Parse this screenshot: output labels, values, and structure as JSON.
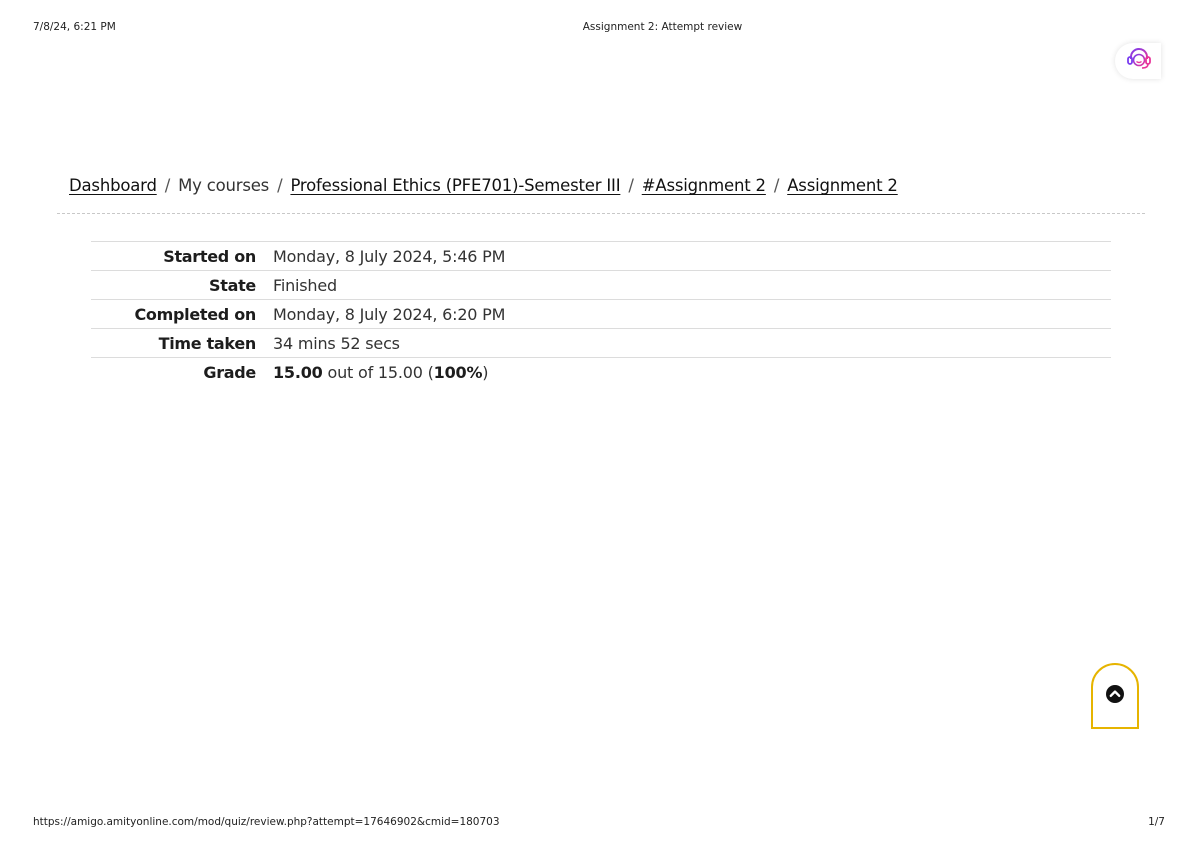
{
  "print_header": {
    "datetime": "7/8/24, 6:21 PM",
    "page_title": "Assignment 2: Attempt review"
  },
  "support": {
    "icon": "headset-support-icon"
  },
  "breadcrumb": {
    "items": [
      {
        "label": "Dashboard",
        "link": true
      },
      {
        "label": "My courses",
        "link": false
      },
      {
        "label": "Professional Ethics (PFE701)-Semester III",
        "link": true
      },
      {
        "label": "#Assignment 2",
        "link": true
      },
      {
        "label": "Assignment 2",
        "link": true
      }
    ],
    "separator": "/"
  },
  "summary": {
    "started_on_label": "Started on",
    "started_on_value": "Monday, 8 July 2024, 5:46 PM",
    "state_label": "State",
    "state_value": "Finished",
    "completed_on_label": "Completed on",
    "completed_on_value": "Monday, 8 July 2024, 6:20 PM",
    "time_taken_label": "Time taken",
    "time_taken_value": "34 mins 52 secs",
    "grade_label": "Grade",
    "grade_score": "15.00",
    "grade_out_of": "out of 15.00 (",
    "grade_percent": "100%",
    "grade_close": ")"
  },
  "scroll_top": {
    "icon": "chevron-up-circle-icon",
    "accent_color": "#e6b400"
  },
  "print_footer": {
    "url": "https://amigo.amityonline.com/mod/quiz/review.php?attempt=17646902&cmid=180703",
    "page_indicator": "1/7"
  }
}
